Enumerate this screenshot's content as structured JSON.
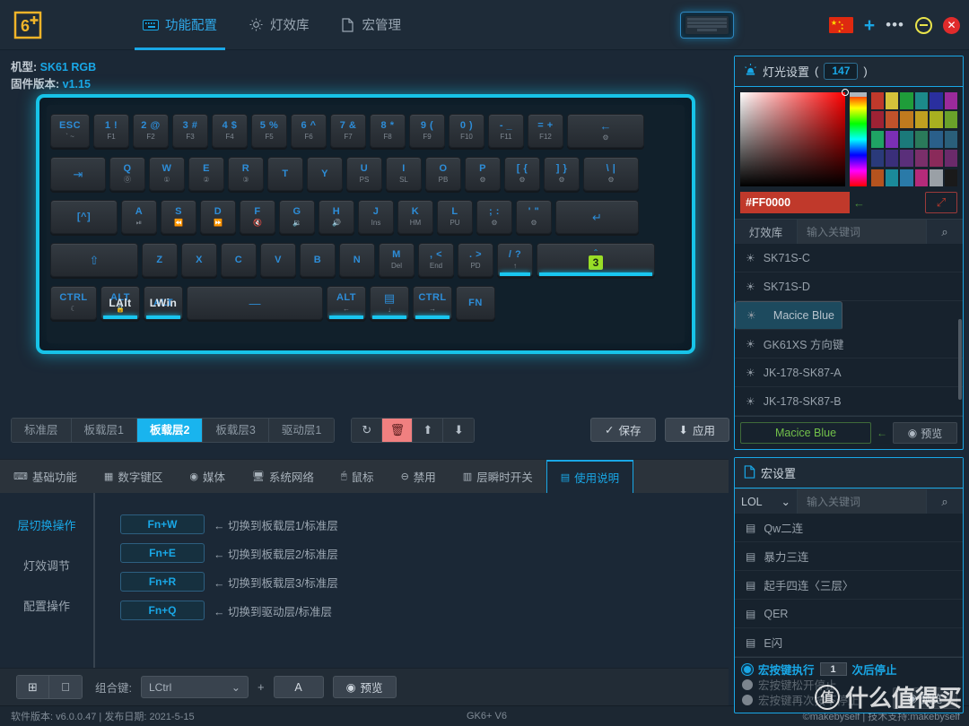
{
  "header": {
    "logo_alt": "6+ logo",
    "nav": [
      {
        "label": "功能配置",
        "icon": "keyboard-icon",
        "active": true
      },
      {
        "label": "灯效库",
        "icon": "sun-icon",
        "active": false
      },
      {
        "label": "宏管理",
        "icon": "document-icon",
        "active": false
      }
    ],
    "keyboard_preview_alt": "keyboard",
    "flag_alt": "china-flag",
    "plus": "+",
    "dots": "•••",
    "minimize": "–",
    "close": "✕"
  },
  "info": {
    "model_label": "机型:",
    "model_value": "SK61 RGB",
    "firmware_label": "固件版本:",
    "firmware_value": "v1.15"
  },
  "keyboard": {
    "row1": [
      {
        "top": "ESC",
        "bot": "` ~"
      },
      {
        "top": "1 !",
        "bot": "F1"
      },
      {
        "top": "2 @",
        "bot": "F2"
      },
      {
        "top": "3 #",
        "bot": "F3"
      },
      {
        "top": "4 $",
        "bot": "F4"
      },
      {
        "top": "5 %",
        "bot": "F5"
      },
      {
        "top": "6 ^",
        "bot": "F6"
      },
      {
        "top": "7 &",
        "bot": "F7"
      },
      {
        "top": "8 *",
        "bot": "F8"
      },
      {
        "top": "9 (",
        "bot": "F9"
      },
      {
        "top": "0 )",
        "bot": "F10"
      },
      {
        "top": "- _",
        "bot": "F11"
      },
      {
        "top": "= +",
        "bot": "F12"
      },
      {
        "top": "←",
        "bot": "⚙"
      }
    ],
    "row2": [
      {
        "top": "⇥",
        "bot": ""
      },
      {
        "top": "Q",
        "bot": "⓪"
      },
      {
        "top": "W",
        "bot": "①"
      },
      {
        "top": "E",
        "bot": "②"
      },
      {
        "top": "R",
        "bot": "③"
      },
      {
        "top": "T",
        "bot": ""
      },
      {
        "top": "Y",
        "bot": ""
      },
      {
        "top": "U",
        "bot": "PS"
      },
      {
        "top": "I",
        "bot": "SL"
      },
      {
        "top": "O",
        "bot": "PB"
      },
      {
        "top": "P",
        "bot": "⚙"
      },
      {
        "top": "[ {",
        "bot": "⚙"
      },
      {
        "top": "] }",
        "bot": "⚙"
      },
      {
        "top": "\\ |",
        "bot": "⚙"
      }
    ],
    "row3": [
      {
        "top": "[^]",
        "bot": ""
      },
      {
        "top": "A",
        "bot": "⏯"
      },
      {
        "top": "S",
        "bot": "⏪"
      },
      {
        "top": "D",
        "bot": "⏩"
      },
      {
        "top": "F",
        "bot": "🔇"
      },
      {
        "top": "G",
        "bot": "🔉"
      },
      {
        "top": "H",
        "bot": "🔊"
      },
      {
        "top": "J",
        "bot": "Ins"
      },
      {
        "top": "K",
        "bot": "HM"
      },
      {
        "top": "L",
        "bot": "PU"
      },
      {
        "top": "; :",
        "bot": "⚙"
      },
      {
        "top": "' \"",
        "bot": "⚙"
      },
      {
        "top": "↵",
        "bot": ""
      }
    ],
    "row4": [
      {
        "top": "⇧",
        "bot": ""
      },
      {
        "top": "Z",
        "bot": ""
      },
      {
        "top": "X",
        "bot": ""
      },
      {
        "top": "C",
        "bot": ""
      },
      {
        "top": "V",
        "bot": ""
      },
      {
        "top": "B",
        "bot": ""
      },
      {
        "top": "N",
        "bot": ""
      },
      {
        "top": "M",
        "bot": "Del"
      },
      {
        "top": ", <",
        "bot": "End"
      },
      {
        "top": ". >",
        "bot": "PD"
      },
      {
        "top": "/ ?",
        "bot": "↑",
        "lit": true
      },
      {
        "top": "3",
        "bot": "",
        "badge": true,
        "lit": true
      }
    ],
    "row5": [
      {
        "top": "CTRL",
        "bot": "☾"
      },
      {
        "top": "ALT",
        "over": "LAlt",
        "bot": "🔒",
        "lit": true
      },
      {
        "top": "ALT",
        "over": "LWin",
        "bot": "",
        "lit": true
      },
      {
        "top": "—",
        "bot": ""
      },
      {
        "top": "ALT",
        "bot": "←",
        "lit": true
      },
      {
        "top": "▤",
        "bot": "↓",
        "lit": true
      },
      {
        "top": "CTRL",
        "bot": "→",
        "lit": true
      },
      {
        "top": "FN",
        "bot": ""
      }
    ]
  },
  "layers": {
    "tabs": [
      {
        "label": "标准层",
        "active": false
      },
      {
        "label": "板载层1",
        "active": false
      },
      {
        "label": "板载层2",
        "active": true
      },
      {
        "label": "板载层3",
        "active": false
      },
      {
        "label": "驱动层1",
        "active": false
      }
    ],
    "tools": [
      {
        "icon": "refresh-icon",
        "glyph": "↻"
      },
      {
        "icon": "trash-icon",
        "glyph": "🗑"
      },
      {
        "icon": "upload-icon",
        "glyph": "⬆"
      },
      {
        "icon": "download-icon",
        "glyph": "⬇"
      }
    ],
    "save_label": "保存",
    "apply_label": "应用"
  },
  "function_tabs": [
    {
      "label": "基础功能",
      "icon": "keyboard-icon",
      "glyph": "⌨",
      "active": false
    },
    {
      "label": "数字键区",
      "icon": "numpad-icon",
      "glyph": "▦",
      "active": false
    },
    {
      "label": "媒体",
      "icon": "media-icon",
      "glyph": "◉",
      "active": false
    },
    {
      "label": "系统网络",
      "icon": "monitor-icon",
      "glyph": "🖥",
      "active": false
    },
    {
      "label": "鼠标",
      "icon": "mouse-icon",
      "glyph": "🖱",
      "active": false
    },
    {
      "label": "禁用",
      "icon": "ban-icon",
      "glyph": "⊖",
      "active": false
    },
    {
      "label": "层瞬时开关",
      "icon": "layer-icon",
      "glyph": "▥",
      "active": false
    },
    {
      "label": "使用说明",
      "icon": "manual-icon",
      "glyph": "▤",
      "active": true
    }
  ],
  "usage": {
    "side_items": [
      {
        "label": "层切换操作",
        "active": true
      },
      {
        "label": "灯效调节",
        "active": false
      },
      {
        "label": "配置操作",
        "active": false
      }
    ],
    "rows": [
      {
        "key": "Fn+W",
        "desc": "← 切换到板载层1/标准层"
      },
      {
        "key": "Fn+E",
        "desc": "← 切换到板载层2/标准层"
      },
      {
        "key": "Fn+R",
        "desc": "← 切换到板载层3/标准层"
      },
      {
        "key": "Fn+Q",
        "desc": "← 切换到驱动层/标准层"
      }
    ]
  },
  "bottombar": {
    "os_windows_icon": "windows-icon",
    "os_apple_icon": "apple-icon",
    "combo_label": "组合键:",
    "combo_value": "LCtrl",
    "plus": "+",
    "akey": "A",
    "preview_label": "预览"
  },
  "status": {
    "version_text": "软件版本: v6.0.0.47 | 发布日期: 2021-5-15",
    "device": "GK6+ V6",
    "copyright": "©makebyself | 技术支持:makebyself"
  },
  "light_panel": {
    "title": "灯光设置",
    "paren_open": "(",
    "count": "147",
    "paren_close": ")",
    "hex_value": "#FF0000",
    "hex_arrow": "←",
    "eyedropper_icon": "eyedropper-icon",
    "swatches": [
      "#c0392b",
      "#d4c23a",
      "#1f9d3a",
      "#1c8a8a",
      "#2a2f9e",
      "#9b2a9b",
      "#9e2234",
      "#c0522b",
      "#c07a1e",
      "#c0a020",
      "#a8b020",
      "#6aa12a",
      "#1fa364",
      "#7b2fb5",
      "#1b7a7a",
      "#2a7a5a",
      "#2a5f8a",
      "#2a5f7a",
      "#2a3a7a",
      "#3a2f7a",
      "#5a2f7a",
      "#7a2f6a",
      "#8a2a5a",
      "#6a2a6a",
      "#b5531e",
      "#1b8a9a",
      "#2a7aa8",
      "#b52a7a",
      "#9aa0a6",
      "#1a1a1a"
    ],
    "search": {
      "label": "灯效库",
      "placeholder": "输入关键词",
      "search_icon": "search-icon"
    },
    "items": [
      {
        "label": "SK71S-C",
        "selected": false
      },
      {
        "label": "SK71S-D",
        "selected": false
      },
      {
        "label": "Macice Blue",
        "selected": true
      },
      {
        "label": "GK61XS 方向键",
        "selected": false
      },
      {
        "label": "JK-178-SK87-A",
        "selected": false
      },
      {
        "label": "JK-178-SK87-B",
        "selected": false
      }
    ],
    "footer_name": "Macice Blue",
    "footer_arrow": "←",
    "footer_preview": "预览"
  },
  "macro_panel": {
    "title": "宏设置",
    "select_value": "LOL",
    "placeholder": "输入关键词",
    "search_icon": "search-icon",
    "items": [
      {
        "label": "Qw二连"
      },
      {
        "label": "暴力三连"
      },
      {
        "label": "起手四连〈三层〉"
      },
      {
        "label": "QER"
      },
      {
        "label": "E闪"
      }
    ],
    "radios": [
      {
        "pre": "宏按键执行",
        "count": "1",
        "post": "次后停止",
        "selected": true
      },
      {
        "label": "宏按键松开停止",
        "selected": false
      },
      {
        "label": "宏按键再次按下停止",
        "selected": false
      }
    ],
    "preview_label": "预览"
  },
  "watermark": {
    "circle": "值",
    "text": "什么值得买"
  },
  "colors": {
    "accent": "#19a7e6",
    "active_tab": "#19b4ee",
    "glow": "#17c3e8",
    "hex": "#FF0000",
    "highlight_key": "#9ade26"
  }
}
